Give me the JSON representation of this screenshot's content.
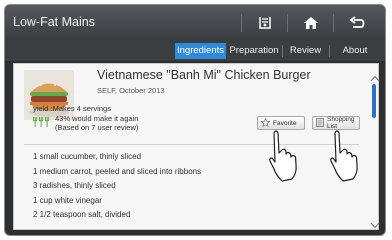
{
  "header": {
    "title": "Low-Fat Mains"
  },
  "toolbar": {
    "icons": [
      "recipe-box-icon",
      "home-icon",
      "back-icon"
    ]
  },
  "tabs": [
    {
      "label": "Ingredients",
      "active": true
    },
    {
      "label": "Preparation",
      "active": false
    },
    {
      "label": "Review",
      "active": false
    },
    {
      "label": "About",
      "active": false
    }
  ],
  "recipe": {
    "title": "Vietnamese \"Banh Mi\" Chicken Burger",
    "source": "SELF, October 2013",
    "yield": "yield :Makes 4 servings",
    "rating_line1": "43% would make it again",
    "rating_line2": "(Based on 7 user review)",
    "rating_fraction": 0.43
  },
  "buttons": {
    "favorite": "Favorite",
    "shopping_list": "Shopping List"
  },
  "ingredients": [
    "1 small cucumber, thinly sliced",
    "1 medium carrot, peeled and sliced into ribbons",
    "3 radishes, thinly sliced",
    "1 cup white vinegar",
    "2 1/2 teaspoon salt, divided"
  ],
  "colors": {
    "accent": "#2f8ad8",
    "rating": "#6aa84f"
  }
}
